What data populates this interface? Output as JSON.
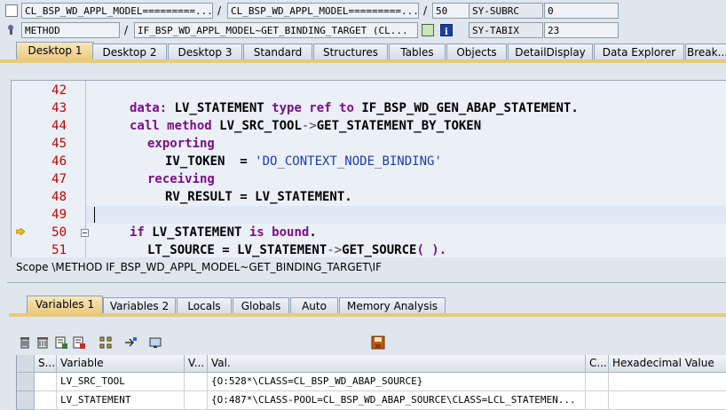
{
  "top": {
    "row1": {
      "program": "CL_BSP_WD_APPL_MODEL=========...",
      "include": "CL_BSP_WD_APPL_MODEL=========...",
      "line": "50",
      "sysfield": "SY-SUBRC",
      "sysvalue": "0"
    },
    "row2": {
      "event_type": "METHOD",
      "event": "IF_BSP_WD_APPL_MODEL~GET_BINDING_TARGET (CL...",
      "sysfield": "SY-TABIX",
      "sysvalue": "23"
    },
    "slash": "/"
  },
  "desktop_tabs": [
    "Desktop 1",
    "Desktop 2",
    "Desktop 3",
    "Standard",
    "Structures",
    "Tables",
    "Objects",
    "DetailDisplay",
    "Data Explorer",
    "Break..."
  ],
  "editor": {
    "line_numbers": [
      "42",
      "43",
      "44",
      "45",
      "46",
      "47",
      "48",
      "49",
      "50",
      "51"
    ]
  },
  "code": {
    "l43_a": "data: ",
    "l43_b": "LV_STATEMENT",
    "l43_c": " type ref to ",
    "l43_d": "IF_BSP_WD_GEN_ABAP_STATEMENT",
    "l43_e": ".",
    "l44_a": "call method ",
    "l44_b": "LV_SRC_TOOL",
    "l44_c": "->",
    "l44_d": "GET_STATEMENT_BY_TOKEN",
    "l45_a": "exporting",
    "l46_a": "IV_TOKEN  = ",
    "l46_b": "'DO_CONTEXT_NODE_BINDING'",
    "l47_a": "receiving",
    "l48_a": "RV_RESULT = LV_STATEMENT",
    "l48_b": ".",
    "l50_a": "if ",
    "l50_b": "LV_STATEMENT",
    "l50_c": " is bound",
    "l50_d": ".",
    "l51_a": "LT_SOURCE = LV_STATEMENT",
    "l51_b": "->",
    "l51_c": "GET_SOURCE",
    "l51_d": "( ).",
    "l51_e": ""
  },
  "scope_text": "Scope \\METHOD IF_BSP_WD_APPL_MODEL~GET_BINDING_TARGET\\IF",
  "variable_tabs": [
    "Variables 1",
    "Variables 2",
    "Locals",
    "Globals",
    "Auto",
    "Memory Analysis"
  ],
  "grid": {
    "headers": [
      "S...",
      "Variable",
      "V...",
      "Val.",
      "C...",
      "Hexadecimal Value"
    ],
    "rows": [
      {
        "variable": "LV_SRC_TOOL",
        "value": "{O:528*\\CLASS=CL_BSP_WD_ABAP_SOURCE}"
      },
      {
        "variable": "LV_STATEMENT",
        "value": "{O:487*\\CLASS-POOL=CL_BSP_WD_ABAP_SOURCE\\CLASS=LCL_STATEMEN..."
      }
    ]
  }
}
